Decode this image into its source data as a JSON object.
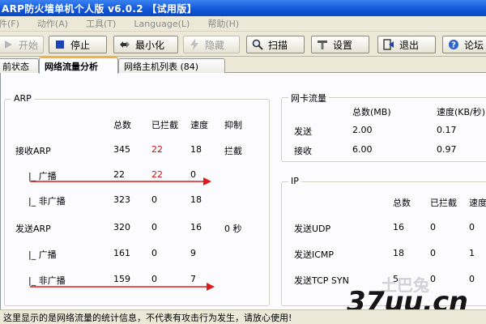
{
  "window": {
    "title": "ARP防火墙单机个人版 v6.0.2 【试用版】"
  },
  "menu": {
    "items": [
      "件(F)",
      "动作(A)",
      "工具(T)",
      "Language(L)",
      "帮助(H)"
    ]
  },
  "toolbar": {
    "start": "开始",
    "stop": "停止",
    "minimize": "最小化",
    "hide": "隐藏",
    "scan": "扫描",
    "settings": "设置",
    "exit": "退出",
    "forum": "论坛"
  },
  "tabs": [
    "前状态",
    "网络流量分析",
    "网络主机列表 (84)"
  ],
  "arp": {
    "title": "ARP",
    "headers": [
      "总数",
      "已拦截",
      "速度",
      "抑制"
    ],
    "rows": [
      {
        "label": "接收ARP",
        "total": "345",
        "blocked": "22",
        "speed": "18",
        "suppress": "拦截"
      },
      {
        "label": "|_ 广播",
        "total": "22",
        "blocked": "22",
        "speed": "0",
        "suppress": ""
      },
      {
        "label": "|_ 非广播",
        "total": "323",
        "blocked": "0",
        "speed": "18",
        "suppress": ""
      },
      {
        "label": "发送ARP",
        "total": "320",
        "blocked": "0",
        "speed": "16",
        "suppress": "0 秒"
      },
      {
        "label": "|_ 广播",
        "total": "161",
        "blocked": "0",
        "speed": "9",
        "suppress": ""
      },
      {
        "label": "|_ 非广播",
        "total": "159",
        "blocked": "0",
        "speed": "7",
        "suppress": ""
      }
    ]
  },
  "nic": {
    "title": "网卡流量",
    "headers": [
      "总数(MB)",
      "速度(KB/秒)"
    ],
    "rows": [
      {
        "label": "发送",
        "total": "2.00",
        "speed": "0.17"
      },
      {
        "label": "接收",
        "total": "6.00",
        "speed": "0.97"
      }
    ]
  },
  "ip": {
    "title": "IP",
    "headers": [
      "总数",
      "已拦截",
      "速度"
    ],
    "rows": [
      {
        "label": "发送UDP",
        "total": "16",
        "blocked": "0",
        "speed": "0"
      },
      {
        "label": "发送ICMP",
        "total": "18",
        "blocked": "0",
        "speed": "1"
      },
      {
        "label": "发送TCP SYN",
        "total": "5",
        "blocked": "0",
        "speed": "0"
      }
    ]
  },
  "status": {
    "text": "这里显示的是网络流量的统计信息，不代表有攻击行为发生，请放心使用!"
  },
  "watermark": {
    "text": "37uu.cn",
    "faint": "土巴兔"
  },
  "colors": {
    "blocked_red": "#d01010",
    "title_blue": "#0f55d6",
    "arrow_red": "#e01818"
  }
}
